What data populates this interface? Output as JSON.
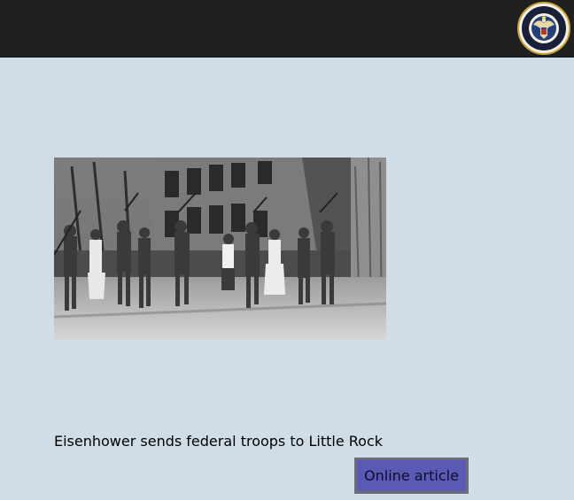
{
  "header": {
    "seal_icon": "presidential-seal-icon",
    "seal_text": "EXECUTIVE OFFICE of the PRESIDENT of the UNITED STATES"
  },
  "main": {
    "photo_icon": "historical-photo-troops",
    "caption": "Eisenhower sends federal troops to Little Rock",
    "button_label": "Online article"
  },
  "colors": {
    "background": "#d0dde7",
    "topbar": "#202020",
    "button_fill": "#5b59b6",
    "button_border": "#6b6b7a"
  }
}
